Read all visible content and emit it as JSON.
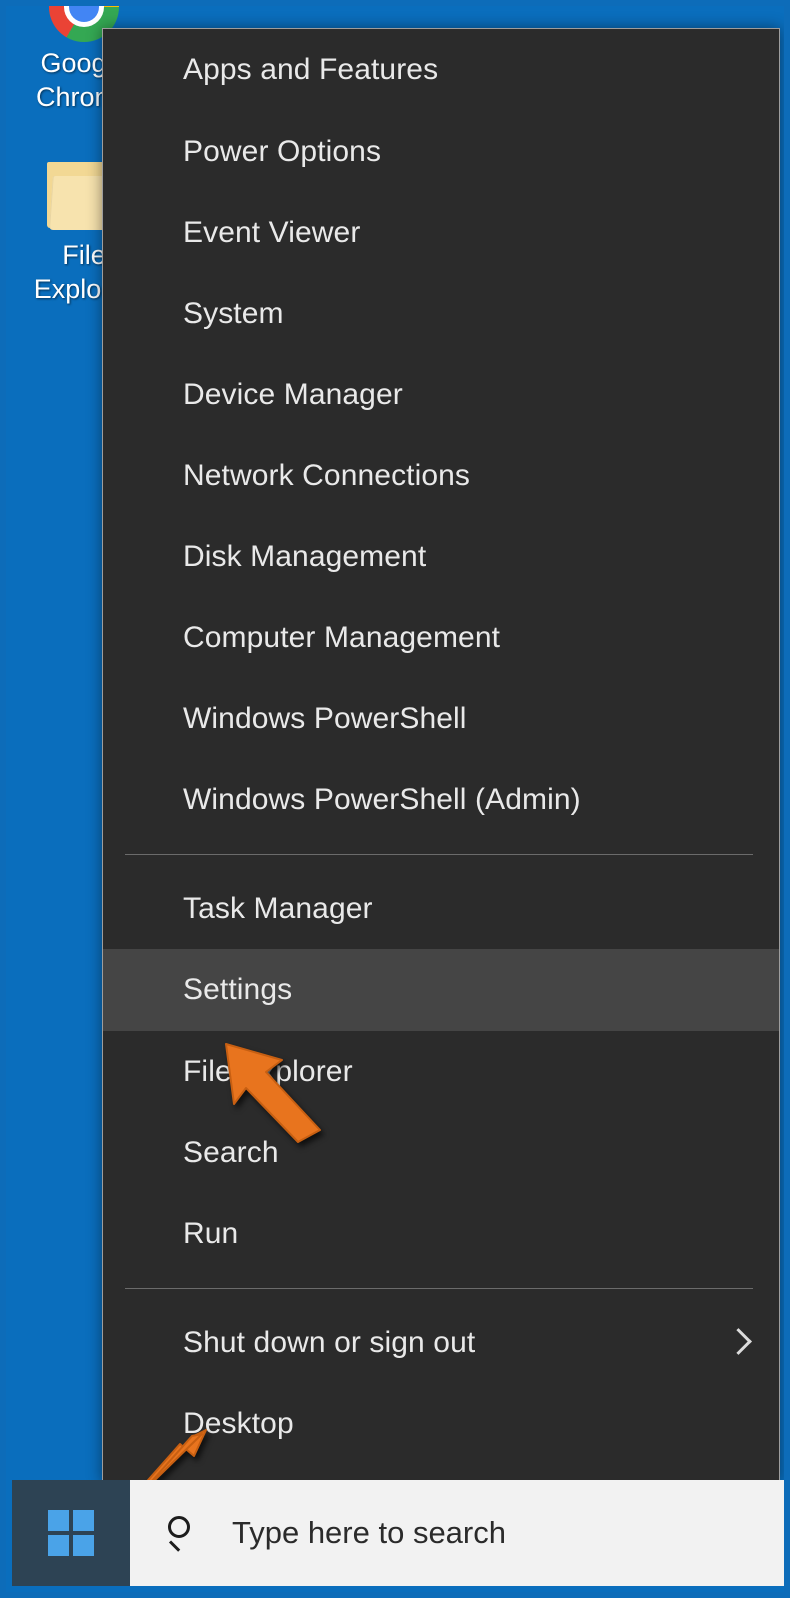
{
  "desktop": {
    "background_color": "#0a6ebd",
    "icons": [
      {
        "name": "google-chrome",
        "label": "Google\nChrome",
        "icon": "chrome-icon"
      },
      {
        "name": "file-explorer",
        "label": "File Explorer",
        "icon": "folder-icon"
      }
    ]
  },
  "context_menu": {
    "background_color": "#2b2b2b",
    "highlight_color": "#454545",
    "border_color": "#9d9d9d",
    "groups": [
      {
        "items": [
          {
            "label": "Apps and Features",
            "highlighted": false,
            "submenu": false
          },
          {
            "label": "Power Options",
            "highlighted": false,
            "submenu": false
          },
          {
            "label": "Event Viewer",
            "highlighted": false,
            "submenu": false
          },
          {
            "label": "System",
            "highlighted": false,
            "submenu": false
          },
          {
            "label": "Device Manager",
            "highlighted": false,
            "submenu": false
          },
          {
            "label": "Network Connections",
            "highlighted": false,
            "submenu": false
          },
          {
            "label": "Disk Management",
            "highlighted": false,
            "submenu": false
          },
          {
            "label": "Computer Management",
            "highlighted": false,
            "submenu": false
          },
          {
            "label": "Windows PowerShell",
            "highlighted": false,
            "submenu": false
          },
          {
            "label": "Windows PowerShell (Admin)",
            "highlighted": false,
            "submenu": false
          }
        ]
      },
      {
        "items": [
          {
            "label": "Task Manager",
            "highlighted": false,
            "submenu": false
          },
          {
            "label": "Settings",
            "highlighted": true,
            "submenu": false
          },
          {
            "label": "File Explorer",
            "highlighted": false,
            "submenu": false
          },
          {
            "label": "Search",
            "highlighted": false,
            "submenu": false
          },
          {
            "label": "Run",
            "highlighted": false,
            "submenu": false
          }
        ]
      },
      {
        "items": [
          {
            "label": "Shut down or sign out",
            "highlighted": false,
            "submenu": true
          },
          {
            "label": "Desktop",
            "highlighted": false,
            "submenu": false
          }
        ]
      }
    ]
  },
  "annotations": {
    "arrow_color": "#e8741e",
    "arrows": [
      {
        "name": "pointer-to-settings",
        "direction": "up-left",
        "target": "Settings"
      },
      {
        "name": "pointer-to-start-button",
        "direction": "down-left",
        "target": "Start"
      }
    ]
  },
  "taskbar": {
    "background_color": "#2d4354",
    "start_button": {
      "name": "start-button",
      "icon": "windows-logo-icon",
      "logo_color": "#4aa3e8"
    },
    "search": {
      "name": "taskbar-search",
      "icon": "search-icon",
      "placeholder": "Type here to search",
      "value": "",
      "background_color": "#f2f2f2"
    }
  }
}
